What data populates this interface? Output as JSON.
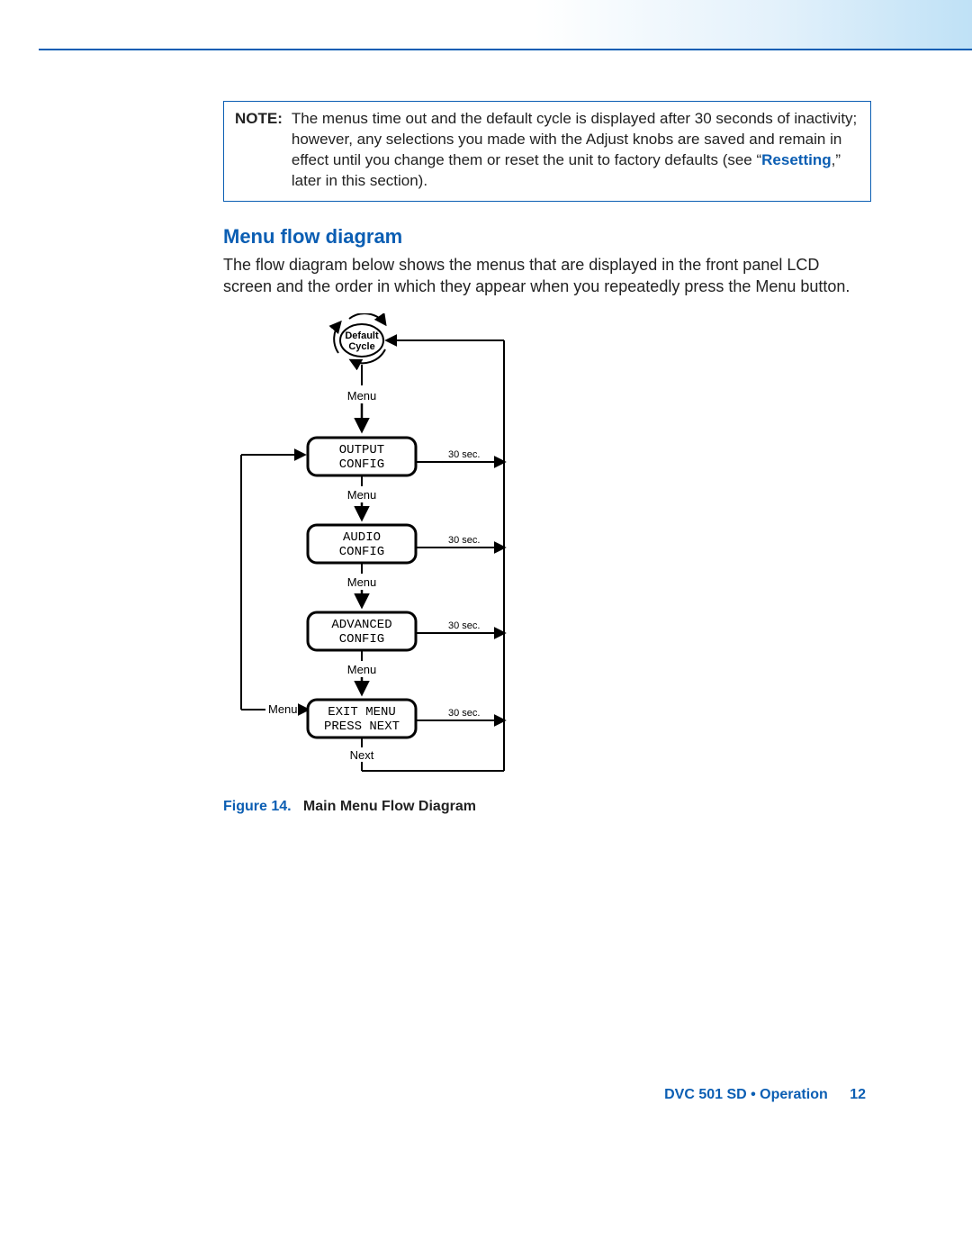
{
  "note": {
    "label": "NOTE:",
    "text_before_link": "The menus time out and the default cycle is displayed after 30 seconds of inactivity; however, any selections you made with the Adjust knobs are saved and remain in effect until you change them or reset the unit to factory defaults (see “",
    "link_text": "Resetting",
    "text_after_link": ",” later in this section)."
  },
  "heading": "Menu flow diagram",
  "body": "The flow diagram below shows the menus that are displayed in the front panel LCD screen and the order in which they appear when you repeatedly press the Menu button.",
  "diagram": {
    "cycle_label_top": "Default",
    "cycle_label_bottom": "Cycle",
    "edge_label": "Menu",
    "timeout_label": "30 sec.",
    "nodes": [
      {
        "line1": "OUTPUT",
        "line2": "CONFIG"
      },
      {
        "line1": "AUDIO",
        "line2": "CONFIG"
      },
      {
        "line1": "ADVANCED",
        "line2": "CONFIG"
      },
      {
        "line1": "EXIT MENU",
        "line2": "PRESS NEXT"
      }
    ],
    "next_label": "Next",
    "left_menu_label": "Menu"
  },
  "figure_caption": {
    "number": "Figure 14.",
    "title": "Main Menu Flow Diagram"
  },
  "footer": {
    "title": "DVC 501 SD • Operation",
    "page": "12"
  }
}
